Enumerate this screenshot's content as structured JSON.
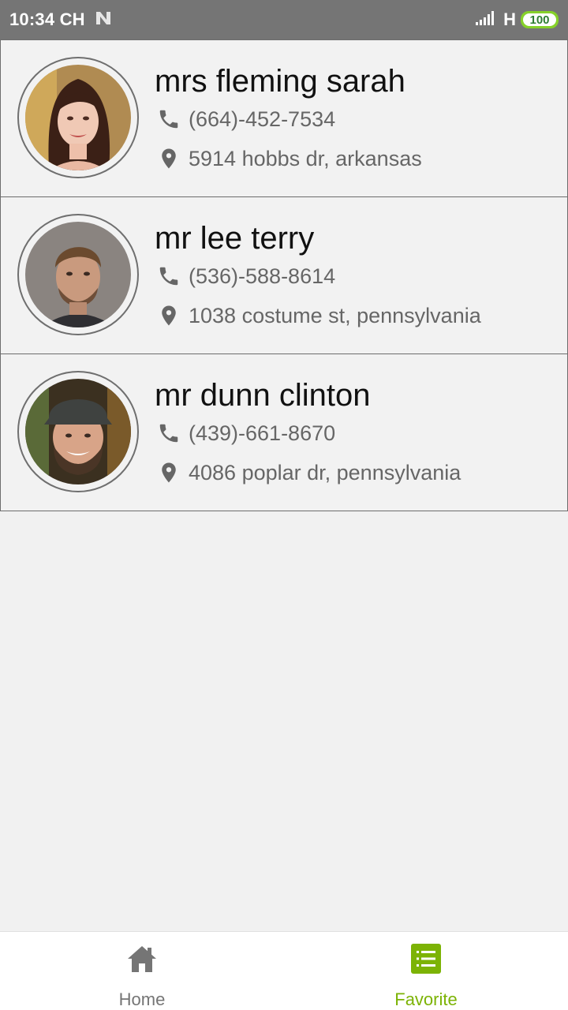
{
  "status_bar": {
    "time": "10:34 CH",
    "network": "H",
    "battery": "100",
    "colors": {
      "bar": "#757575",
      "battery": "#86d12a"
    }
  },
  "contacts": [
    {
      "name": "mrs fleming sarah",
      "phone": "(664)-452-7534",
      "address": "5914 hobbs dr, arkansas",
      "avatar": "woman-avatar"
    },
    {
      "name": "mr lee terry",
      "phone": "(536)-588-8614",
      "address": "1038 costume st, pennsylvania",
      "avatar": "man-avatar"
    },
    {
      "name": "mr dunn clinton",
      "phone": "(439)-661-8670",
      "address": "4086 poplar dr, pennsylvania",
      "avatar": "man-cap-avatar"
    }
  ],
  "bottom_nav": {
    "items": [
      {
        "label": "Home",
        "icon": "home-icon",
        "active": false
      },
      {
        "label": "Favorite",
        "icon": "list-icon",
        "active": true
      }
    ],
    "colors": {
      "active": "#7cb305",
      "inactive": "#757575"
    }
  }
}
